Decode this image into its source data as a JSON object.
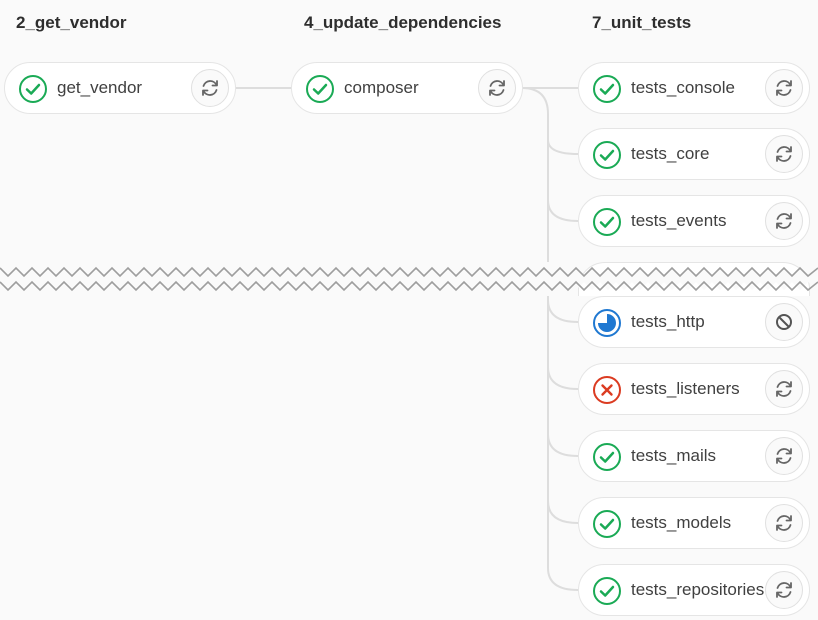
{
  "stages": [
    {
      "title": "2_get_vendor",
      "jobs": [
        {
          "name": "get_vendor",
          "status": "success-icon",
          "action": "retry-icon"
        }
      ]
    },
    {
      "title": "4_update_dependencies",
      "jobs": [
        {
          "name": "composer",
          "status": "success-icon",
          "action": "retry-icon"
        }
      ]
    },
    {
      "title": "7_unit_tests",
      "jobs": [
        {
          "name": "tests_console",
          "status": "success-icon",
          "action": "retry-icon"
        },
        {
          "name": "tests_core",
          "status": "success-icon",
          "action": "retry-icon"
        },
        {
          "name": "tests_events",
          "status": "success-icon",
          "action": "retry-icon"
        },
        {
          "name": "tests_http",
          "status": "running-icon",
          "action": "cancel-icon"
        },
        {
          "name": "tests_listeners",
          "status": "failed-icon",
          "action": "retry-icon"
        },
        {
          "name": "tests_mails",
          "status": "success-icon",
          "action": "retry-icon"
        },
        {
          "name": "tests_models",
          "status": "success-icon",
          "action": "retry-icon"
        },
        {
          "name": "tests_repositories",
          "status": "success-icon",
          "action": "retry-icon"
        }
      ]
    }
  ],
  "colors": {
    "success": "#1aaa55",
    "failed": "#db3b21",
    "running": "#1f78d1",
    "border": "#e5e5e5",
    "connector": "#dddddd"
  }
}
